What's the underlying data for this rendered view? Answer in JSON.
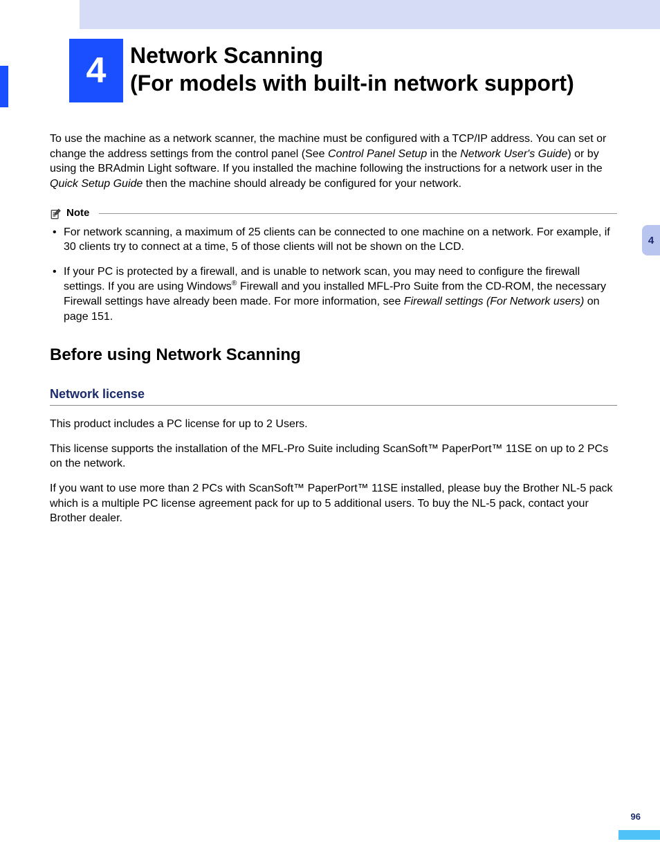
{
  "chapter": {
    "number": "4",
    "title_line1": "Network Scanning",
    "title_line2": "(For models with built-in network support)"
  },
  "side_tab": "4",
  "intro": {
    "pre1": "To use the machine as a network scanner, the machine must be configured with a TCP/IP address. You can set or change the address settings from the control panel (See ",
    "ital1": "Control Panel Setup",
    "mid1": " in the ",
    "ital2": "Network User's Guide",
    "post1": ") or by using the BRAdmin Light software. If you installed the machine following the instructions for a network user in the ",
    "ital3": "Quick Setup Guide",
    "post2": " then the machine should already be configured for your network."
  },
  "note": {
    "label": "Note",
    "items": [
      {
        "text": "For network scanning, a maximum of 25 clients can be connected to one machine on a network. For example, if 30 clients try to connect at a time, 5 of those clients will not be shown on the LCD."
      },
      {
        "pre": "If your PC is protected by a firewall, and is unable to network scan, you may need to configure the firewall settings. If you are using Windows",
        "sup": "®",
        "mid": " Firewall and you installed MFL-Pro Suite from the CD-ROM, the necessary Firewall settings have already been made. For more information, see ",
        "ital": "Firewall settings (For Network users)",
        "post": " on page 151."
      }
    ]
  },
  "section": {
    "h2": "Before using Network Scanning",
    "h3": "Network license",
    "p1": "This product includes a PC license for up to 2 Users.",
    "p2": "This license supports the installation of the MFL-Pro Suite including ScanSoft™ PaperPort™ 11SE on up to 2 PCs on the network.",
    "p3": "If you want to use more than 2 PCs with ScanSoft™ PaperPort™ 11SE installed, please buy the Brother NL-5 pack which is a multiple PC license agreement pack for up to 5 additional users. To buy the NL-5 pack, contact your Brother dealer."
  },
  "page_number": "96"
}
